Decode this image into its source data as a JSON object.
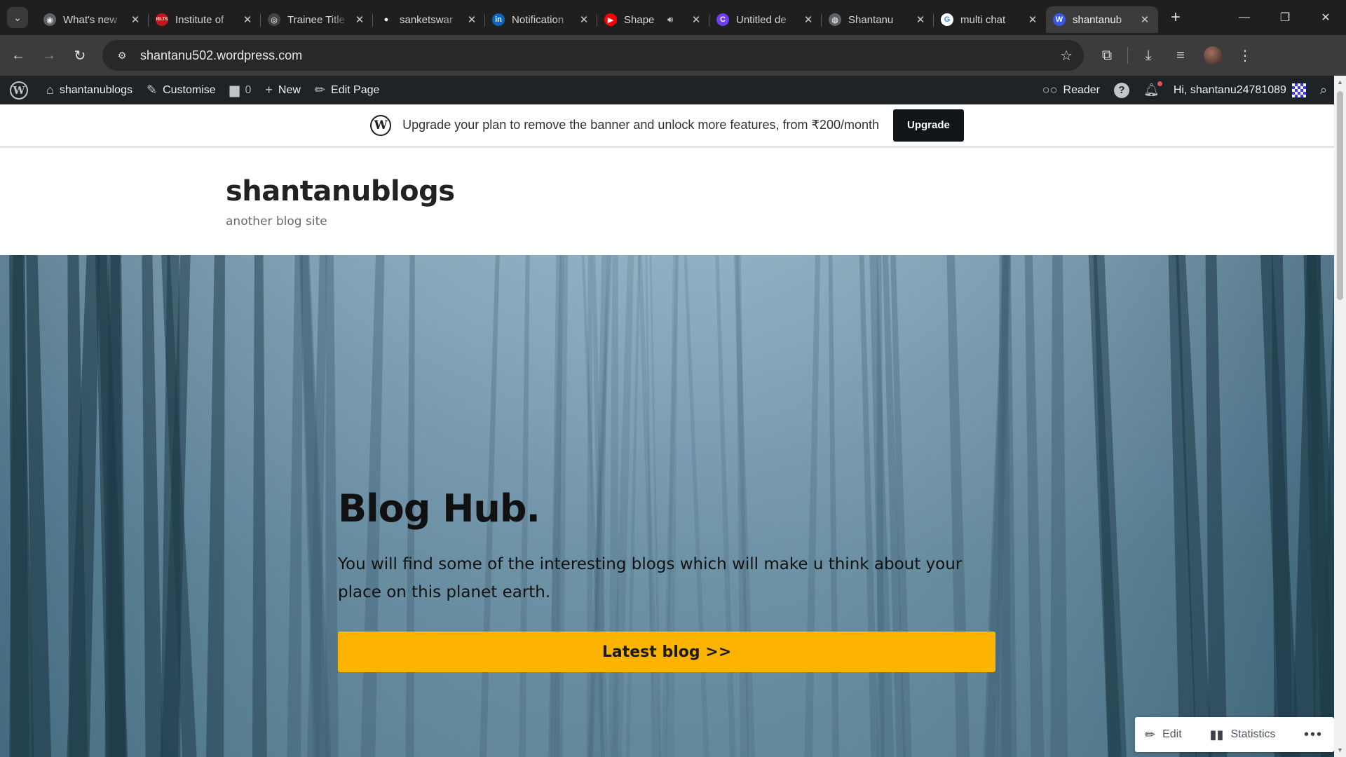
{
  "browser": {
    "tabs": [
      {
        "title": "What's new",
        "favicon": "chrome-icon",
        "fav_color": "#5f6368",
        "fav_char": "◉",
        "audio": false,
        "active": false
      },
      {
        "title": "Institute of",
        "favicon": "ielts-icon",
        "fav_color": "#c4161c",
        "fav_char": "IELTS",
        "audio": false,
        "active": false
      },
      {
        "title": "Trainee Title",
        "favicon": "openai-icon",
        "fav_color": "#444",
        "fav_char": "◎",
        "audio": false,
        "active": false
      },
      {
        "title": "sanketswar",
        "favicon": "github-icon",
        "fav_color": "#1f1f1f",
        "fav_char": "●",
        "audio": false,
        "active": false
      },
      {
        "title": "Notification",
        "favicon": "linkedin-icon",
        "fav_color": "#0a66c2",
        "fav_char": "in",
        "audio": false,
        "active": false
      },
      {
        "title": "Shape",
        "favicon": "youtube-icon",
        "fav_color": "#ff0000",
        "fav_char": "▶",
        "audio": true,
        "active": false
      },
      {
        "title": "Untitled de",
        "favicon": "canva-icon",
        "fav_color": "#6e3df5",
        "fav_char": "C",
        "audio": false,
        "active": false
      },
      {
        "title": "Shantanu",
        "favicon": "globe-icon",
        "fav_color": "#5f6368",
        "fav_char": "◍",
        "audio": false,
        "active": false
      },
      {
        "title": "multi chat",
        "favicon": "google-icon",
        "fav_color": "#ffffff",
        "fav_char": "G",
        "audio": false,
        "active": false
      },
      {
        "title": "shantanub",
        "favicon": "wordpress-icon",
        "fav_color": "#3858e9",
        "fav_char": "W",
        "audio": false,
        "active": true
      }
    ],
    "url": "shantanu502.wordpress.com"
  },
  "adminbar": {
    "site_name": "shantanublogs",
    "customise": "Customise",
    "comments_count": "0",
    "new": "New",
    "edit_page": "Edit Page",
    "reader": "Reader",
    "greeting": "Hi, shantanu24781089"
  },
  "banner": {
    "text": "Upgrade your plan to remove the banner and unlock more features, from ₹200/month",
    "button": "Upgrade"
  },
  "site": {
    "title": "shantanublogs",
    "tagline": "another blog site"
  },
  "hero": {
    "title": "Blog Hub.",
    "description": "You will find some of the interesting blogs which will make u think about your place on this planet earth.",
    "button": "Latest blog >>",
    "button_color": "#fcb400"
  },
  "floatbar": {
    "edit": "Edit",
    "statistics": "Statistics"
  }
}
